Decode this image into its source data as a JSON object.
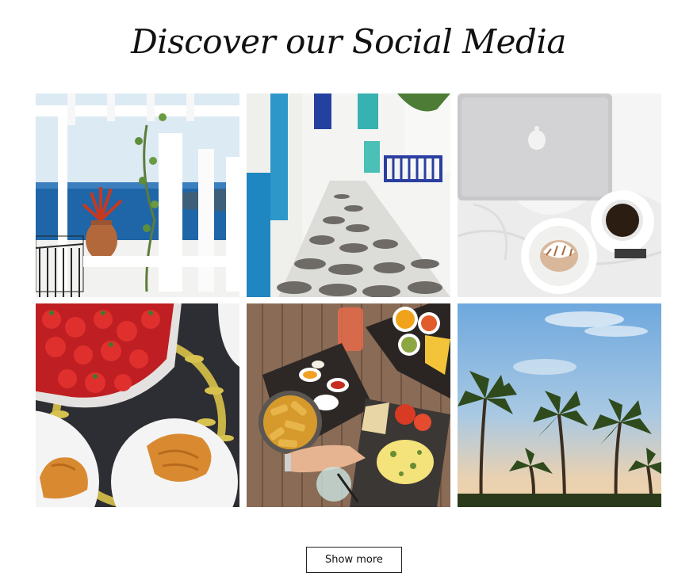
{
  "section": {
    "title": "Discover our Social Media"
  },
  "gallery": {
    "items": [
      {
        "icon": "santorini-terrace-photo"
      },
      {
        "icon": "mykonos-alley-photo"
      },
      {
        "icon": "laptop-coffee-bed-photo"
      },
      {
        "icon": "strawberries-croissants-photo"
      },
      {
        "icon": "tapas-table-photo"
      },
      {
        "icon": "palm-trees-photo"
      }
    ]
  },
  "actions": {
    "show_more_label": "Show more"
  },
  "colors": {
    "background": "#ffffff",
    "title": "#111111",
    "button_border": "#222222"
  }
}
